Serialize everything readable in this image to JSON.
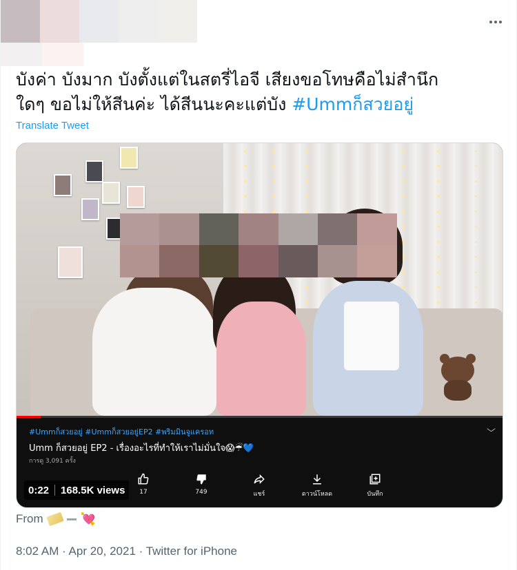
{
  "tweet": {
    "text_line1": "บังค่า บังมาก บังตั้งแต่ในสตรี่ไอจี เสียงขอโทษคือไม่สำนึก",
    "text_line2_plain": "ใดๆ ขอไม่ให้สีนค่ะ ได้สีนนะคะแต่บัง ",
    "hashtag": "#Ummก็สวยอยู่",
    "translate_label": "Translate Tweet",
    "more_icon": "more-horizontal-icon"
  },
  "video": {
    "tags": "#Ummก็สวยอยู่ #Ummก็สวยอยู่EP2 #พริมมินจูแครอท",
    "title": "Umm ก็สวยอยู่ EP2 - เรื่องอะไรที่ทำให้เราไม่มั่นใจ😱☔💙",
    "views_text": "การดู 3,091 ครั้ง",
    "progress": 0.05,
    "duration": "0:22",
    "views_badge": "168.5K views",
    "actions": [
      {
        "icon": "thumbs-up-icon",
        "label": "17"
      },
      {
        "icon": "thumbs-down-icon",
        "label": "749"
      },
      {
        "icon": "share-icon",
        "label": "แชร์"
      },
      {
        "icon": "download-icon",
        "label": "ดาวน์โหลด"
      },
      {
        "icon": "save-icon",
        "label": "บันทึก"
      }
    ]
  },
  "footer": {
    "from_label": "From",
    "timestamp": "8:02 AM · Apr 20, 2021 · Twitter for iPhone"
  },
  "colors": {
    "accent": "#1d9bf0",
    "text": "#0f1419",
    "secondary": "#536471",
    "player_bg": "#0f0f0f"
  }
}
